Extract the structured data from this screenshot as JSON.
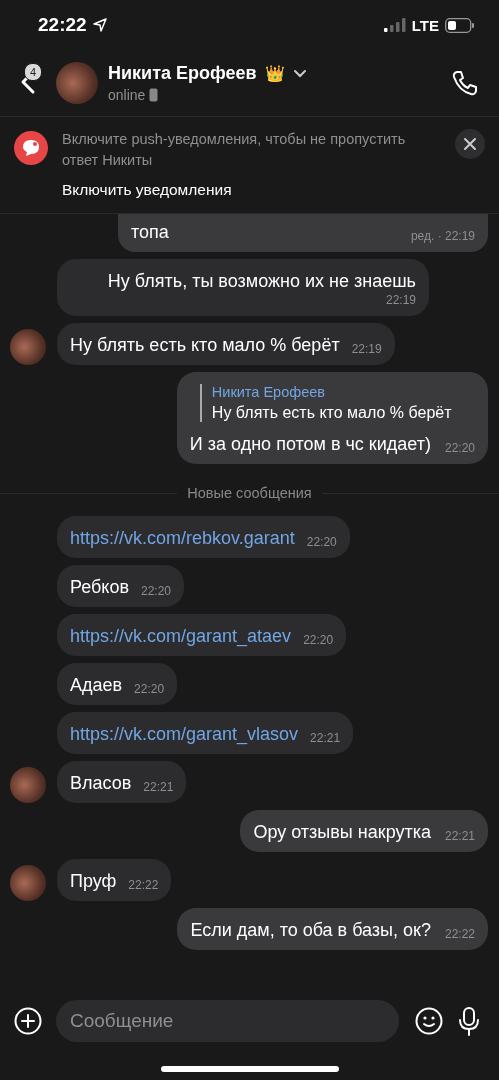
{
  "status_bar": {
    "time": "22:22",
    "network": "LTE"
  },
  "header": {
    "badge": "4",
    "name": "Никита Ерофеев",
    "name_emoji": "👑",
    "status": "online"
  },
  "banner": {
    "text": "Включите push-уведомления, чтобы не пропустить ответ Никиты",
    "action": "Включить уведомления"
  },
  "messages": [
    {
      "kind": "outgoing",
      "text": "топа",
      "time": "ред. · 22:19",
      "cut": true
    },
    {
      "kind": "incoming",
      "text": "Ну блять, ты возможно их не знаешь",
      "time": "22:19",
      "avatar": false
    },
    {
      "kind": "incoming",
      "text": "Ну блять есть кто мало % берёт",
      "time": "22:19",
      "avatar": true
    },
    {
      "kind": "outgoing",
      "reply": {
        "author": "Никита Ерофеев",
        "text": "Ну блять есть кто мало % берёт"
      },
      "text": "И за одно потом в чс кидает)",
      "time": "22:20"
    },
    {
      "kind": "divider",
      "text": "Новые сообщения"
    },
    {
      "kind": "incoming",
      "text": "https://vk.com/rebkov.garant",
      "time": "22:20",
      "link": true,
      "avatar": false
    },
    {
      "kind": "incoming",
      "text": "Ребков",
      "time": "22:20",
      "avatar": false
    },
    {
      "kind": "incoming",
      "text": "https://vk.com/garant_ataev",
      "time": "22:20",
      "link": true,
      "avatar": false
    },
    {
      "kind": "incoming",
      "text": "Адаев",
      "time": "22:20",
      "avatar": false
    },
    {
      "kind": "incoming",
      "text": "https://vk.com/garant_vlasov",
      "time": "22:21",
      "link": true,
      "avatar": false
    },
    {
      "kind": "incoming",
      "text": "Власов",
      "time": "22:21",
      "avatar": true
    },
    {
      "kind": "outgoing",
      "text": "Ору отзывы накрутка",
      "time": "22:21"
    },
    {
      "kind": "incoming",
      "text": "Пруф",
      "time": "22:22",
      "avatar": true
    },
    {
      "kind": "outgoing",
      "text": "Если дам, то оба в базы, ок?",
      "time": "22:22"
    }
  ],
  "composer": {
    "placeholder": "Сообщение"
  }
}
